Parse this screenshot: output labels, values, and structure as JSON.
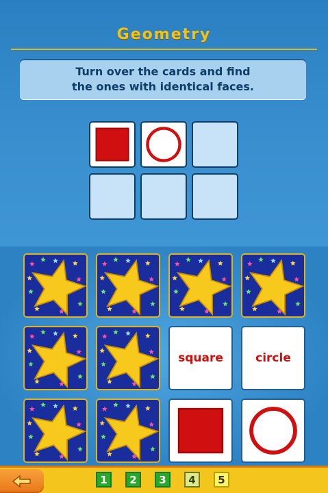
{
  "header": {
    "title": "Geometry"
  },
  "instructions": {
    "line1": "Turn over the cards and find",
    "line2": "the ones with identical faces."
  },
  "found_pairs": [
    {
      "shape": "square"
    },
    {
      "shape": "circle"
    },
    {
      "shape": "empty"
    },
    {
      "shape": "empty"
    },
    {
      "shape": "empty"
    },
    {
      "shape": "empty"
    }
  ],
  "board": {
    "cards": [
      {
        "state": "back"
      },
      {
        "state": "back"
      },
      {
        "state": "back"
      },
      {
        "state": "back"
      },
      {
        "state": "back"
      },
      {
        "state": "back"
      },
      {
        "state": "face",
        "kind": "word",
        "text": "square"
      },
      {
        "state": "face",
        "kind": "word",
        "text": "circle"
      },
      {
        "state": "back"
      },
      {
        "state": "back"
      },
      {
        "state": "face",
        "kind": "shape",
        "shape": "square"
      },
      {
        "state": "face",
        "kind": "shape",
        "shape": "circle"
      }
    ],
    "card_back_icon": "star-icon"
  },
  "footer": {
    "back_icon": "arrow-left-icon",
    "levels": [
      {
        "label": "1",
        "status": "done"
      },
      {
        "label": "2",
        "status": "done"
      },
      {
        "label": "3",
        "status": "done"
      },
      {
        "label": "4",
        "status": "current"
      },
      {
        "label": "5",
        "status": "open"
      }
    ]
  },
  "colors": {
    "title": "#f2c21a",
    "shape_red": "#d01010",
    "card_back": "#1a2d9c",
    "star": "#f6c91c",
    "footer": "#f3c51d"
  }
}
